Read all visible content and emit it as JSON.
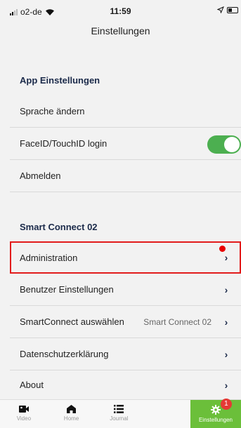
{
  "status_bar": {
    "carrier": "o2-de",
    "time": "11:59"
  },
  "header": {
    "title": "Einstellungen"
  },
  "app_settings": {
    "title": "App Einstellungen",
    "items": [
      {
        "label": "Sprache ändern"
      },
      {
        "label": "FaceID/TouchID login",
        "toggle_on": true
      },
      {
        "label": "Abmelden"
      }
    ]
  },
  "smart_connect": {
    "title": "Smart Connect 02",
    "items": [
      {
        "label": "Administration",
        "notification_dot": true
      },
      {
        "label": "Benutzer Einstellungen"
      },
      {
        "label": "SmartConnect auswählen",
        "value": "Smart Connect 02"
      },
      {
        "label": "Datenschutzerklärung"
      },
      {
        "label": "About"
      }
    ]
  },
  "tabbar": {
    "tabs": [
      {
        "label": "Video",
        "icon": "video-camera-icon"
      },
      {
        "label": "Home",
        "icon": "home-icon"
      },
      {
        "label": "Journal",
        "icon": "list-icon"
      },
      {
        "label": "",
        "icon": ""
      },
      {
        "label": "Einstellungen",
        "icon": "gear-icon",
        "badge": "1",
        "active": true
      }
    ]
  },
  "colors": {
    "accent_green": "#6bbf3a",
    "toggle_green": "#4caf50",
    "highlight_red": "#e21b1b",
    "section_title": "#1b2a4a"
  }
}
